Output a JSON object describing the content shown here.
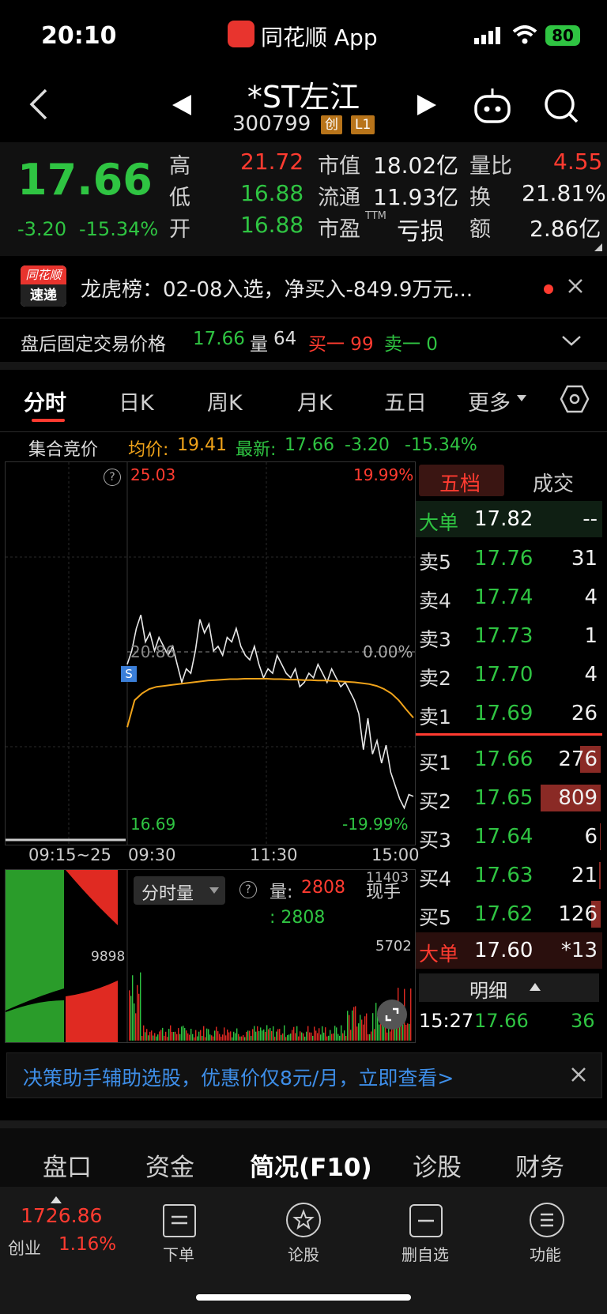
{
  "status": {
    "time": "20:10",
    "app_name": "同花顺 App",
    "battery": "80"
  },
  "header": {
    "title": "*ST左江",
    "code": "300799",
    "tag1": "创",
    "tag2": "L1"
  },
  "quote": {
    "price": "17.66",
    "change": "-3.20",
    "change_pct": "-15.34%",
    "high_label": "高",
    "high": "21.72",
    "low_label": "低",
    "low": "16.88",
    "open_label": "开",
    "open": "16.88",
    "mcap_label": "市值",
    "mcap": "18.02亿",
    "float_label": "流通",
    "float": "11.93亿",
    "pe_label": "市盈",
    "pe_sup": "TTM",
    "pe": "亏损",
    "vol_ratio_label": "量比",
    "vol_ratio": "4.55",
    "turnover_label": "换",
    "turnover": "21.81%",
    "amount_label": "额",
    "amount": "2.86亿"
  },
  "news": {
    "logo_top": "同花顺",
    "logo_bottom": "速递",
    "text": "龙虎榜：02-08入选，净买入-849.9万元..."
  },
  "after_hours": {
    "label": "盘后固定交易价格",
    "price": "17.66",
    "vol_label": "量",
    "vol": "64",
    "buy1": "买一 99",
    "sell1": "卖一 0"
  },
  "tabs": [
    "分时",
    "日K",
    "周K",
    "月K",
    "五日",
    "更多"
  ],
  "chart_header": {
    "auction": "集合竞价",
    "avg_label": "均价:",
    "avg": "19.41",
    "latest_label": "最新:",
    "latest": "17.66",
    "chg": "-3.20",
    "chg_pct": "-15.34%"
  },
  "chart_data": {
    "type": "line",
    "y_max_label": "25.03",
    "y_min_label": "16.69",
    "pct_max": "19.99%",
    "pct_min": "-19.99%",
    "zero_pct": "0.00%",
    "mid_label": "20.86",
    "ylim": [
      16.69,
      25.03
    ],
    "x_labels": [
      "09:15~25",
      "09:30",
      "11:30",
      "15:00"
    ],
    "series": [
      {
        "values": [
          20.6,
          20.9,
          21.4,
          21.7,
          21.1,
          21.3,
          20.9,
          21.2,
          21.0,
          20.8,
          21.0,
          20.6,
          20.2,
          20.5,
          20.4,
          20.9,
          21.6,
          21.3,
          21.5,
          20.9,
          21.0,
          20.8,
          21.2,
          21.1,
          21.4,
          21.0,
          20.8,
          20.7,
          21.0,
          20.6,
          20.3,
          20.5,
          20.4,
          20.8,
          20.6,
          20.4,
          20.3,
          20.5,
          20.1,
          20.2,
          20.4,
          20.3,
          20.6,
          20.4,
          20.2,
          20.5,
          20.3,
          20.1,
          20.2,
          20.0,
          19.8,
          19.5,
          18.7,
          19.4,
          18.6,
          18.9,
          18.4,
          18.8,
          18.2,
          17.9,
          17.6,
          17.4,
          17.7,
          17.66
        ]
      },
      {
        "values": [
          19.2,
          19.8,
          19.95,
          20.05,
          20.1,
          20.12,
          20.14,
          20.16,
          20.18,
          20.2,
          20.22,
          20.24,
          20.25,
          20.26,
          20.27,
          20.27,
          20.28,
          20.28,
          20.28,
          20.28,
          20.27,
          20.27,
          20.26,
          20.26,
          20.25,
          20.25,
          20.24,
          20.24,
          20.23,
          20.22,
          20.21,
          20.2,
          20.18,
          20.16,
          20.12,
          20.05,
          19.95,
          19.8,
          19.6,
          19.41
        ]
      }
    ]
  },
  "volume": {
    "label": "分时量",
    "qty_label": "量:",
    "qty": "2808",
    "qty2": ": 2808",
    "hand_label": "现手",
    "axis_max": "11403",
    "axis_mid": "5702",
    "auction_mid": "9898"
  },
  "orderbook": {
    "tab1": "五档",
    "tab2": "成交",
    "big_top": {
      "label": "大单",
      "price": "17.82",
      "qty": "--"
    },
    "sells": [
      {
        "label": "卖5",
        "price": "17.76",
        "qty": "31"
      },
      {
        "label": "卖4",
        "price": "17.74",
        "qty": "4"
      },
      {
        "label": "卖3",
        "price": "17.73",
        "qty": "1"
      },
      {
        "label": "卖2",
        "price": "17.70",
        "qty": "4"
      },
      {
        "label": "卖1",
        "price": "17.69",
        "qty": "26"
      }
    ],
    "buys": [
      {
        "label": "买1",
        "price": "17.66",
        "qty": "276"
      },
      {
        "label": "买2",
        "price": "17.65",
        "qty": "809"
      },
      {
        "label": "买3",
        "price": "17.64",
        "qty": "6"
      },
      {
        "label": "买4",
        "price": "17.63",
        "qty": "21"
      },
      {
        "label": "买5",
        "price": "17.62",
        "qty": "126"
      }
    ],
    "big_bottom": {
      "label": "大单",
      "price": "17.60",
      "qty": "*13"
    },
    "detail_label": "明细",
    "trade": {
      "time": "15:27",
      "price": "17.66",
      "qty": "36"
    }
  },
  "promo": {
    "text": "决策助手辅助选股，优惠价仅8元/月，立即查看>"
  },
  "bottom_tabs": [
    "盘口",
    "资金",
    "简况(F10)",
    "诊股",
    "财务"
  ],
  "nav": {
    "index_value": "1726.86",
    "index_name": "创业",
    "index_pct": "1.16%",
    "items": [
      "下单",
      "论股",
      "删自选",
      "功能"
    ]
  }
}
